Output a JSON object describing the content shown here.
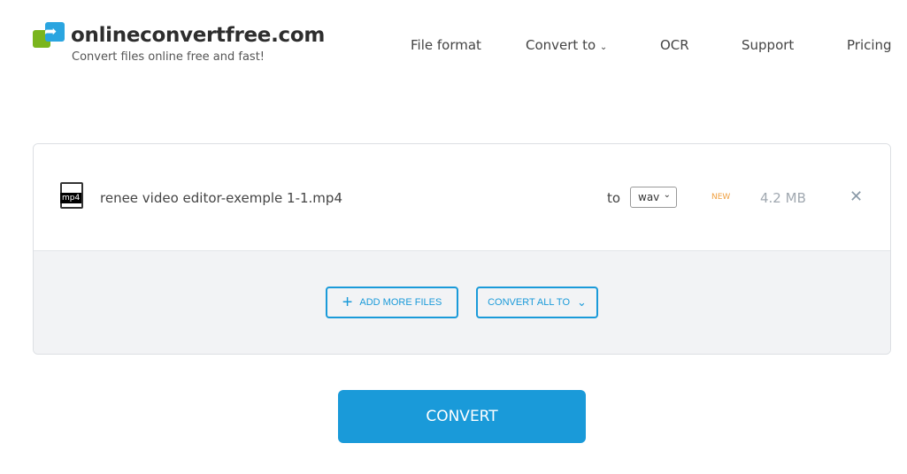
{
  "header": {
    "brand": "onlineconvertfree.com",
    "tagline": "Convert files online free and fast!",
    "nav": [
      {
        "label": "File format"
      },
      {
        "label": "Convert to",
        "chevron": "chevron-down-icon"
      },
      {
        "label": "OCR"
      },
      {
        "label": "Support"
      },
      {
        "label": "Pricing"
      }
    ]
  },
  "file": {
    "icon_label": "mp4",
    "name": "renee video editor-exemple 1-1.mp4",
    "to_label": "to",
    "format": "wav",
    "badge": "NEW",
    "size": "4.2 MB"
  },
  "actions": {
    "add_more": "ADD MORE FILES",
    "convert_all": "CONVERT ALL TO",
    "convert": "CONVERT"
  },
  "colors": {
    "accent": "#1a9ad9",
    "badge": "#f0a040",
    "logo_green": "#7ab51d",
    "logo_blue": "#2aa5e0"
  }
}
